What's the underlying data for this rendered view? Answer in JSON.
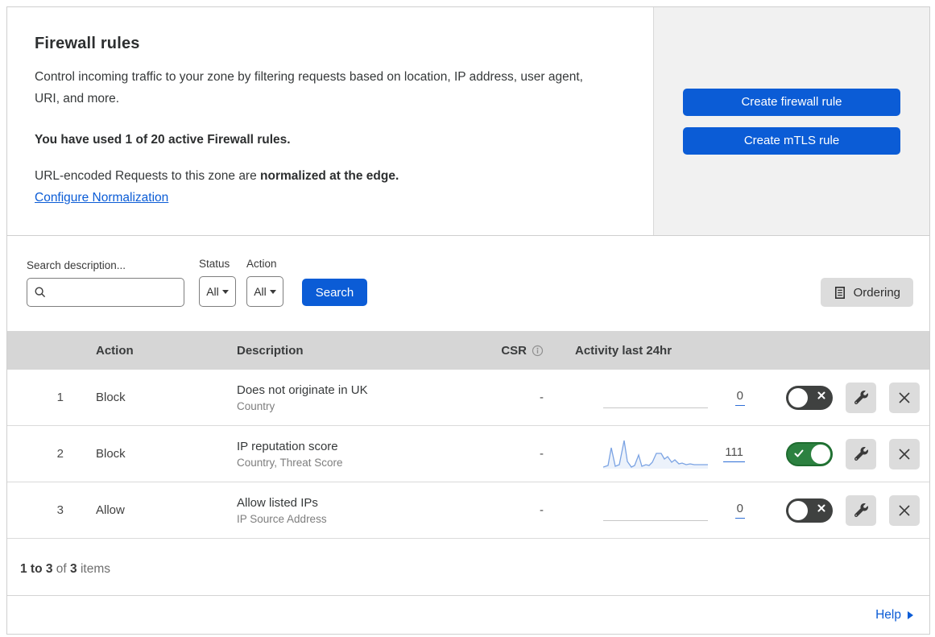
{
  "hero": {
    "title": "Firewall rules",
    "description": "Control incoming traffic to your zone by filtering requests based on location, IP address, user agent, URI, and more.",
    "usage": "You have used 1 of 20 active Firewall rules.",
    "normalization_prefix": "URL-encoded Requests to this zone are ",
    "normalization_bold": "normalized at the edge.",
    "normalization_link": "Configure Normalization",
    "buttons": [
      {
        "label": "Create firewall rule"
      },
      {
        "label": "Create mTLS rule"
      }
    ]
  },
  "filters": {
    "search_label": "Search description...",
    "search_value": "",
    "status_label": "Status",
    "status_value": "All",
    "action_label": "Action",
    "action_value": "All",
    "search_button": "Search",
    "ordering_button": "Ordering"
  },
  "table": {
    "columns": {
      "action": "Action",
      "description": "Description",
      "csr": "CSR",
      "activity": "Activity last 24hr"
    },
    "rows": [
      {
        "num": "1",
        "action": "Block",
        "title": "Does not originate in UK",
        "subtitle": "Country",
        "csr": "-",
        "activity_value": "0",
        "enabled": false,
        "sparkline": null
      },
      {
        "num": "2",
        "action": "Block",
        "title": "IP reputation score",
        "subtitle": "Country, Threat Score",
        "csr": "-",
        "activity_value": "111",
        "enabled": true,
        "sparkline": [
          [
            0,
            38
          ],
          [
            6,
            36
          ],
          [
            10,
            14
          ],
          [
            15,
            37
          ],
          [
            20,
            35
          ],
          [
            26,
            5
          ],
          [
            30,
            31
          ],
          [
            35,
            38
          ],
          [
            39,
            36
          ],
          [
            44,
            23
          ],
          [
            48,
            37
          ],
          [
            53,
            35
          ],
          [
            57,
            36
          ],
          [
            61,
            32
          ],
          [
            66,
            21
          ],
          [
            72,
            21
          ],
          [
            76,
            28
          ],
          [
            80,
            25
          ],
          [
            85,
            32
          ],
          [
            89,
            29
          ],
          [
            94,
            34
          ],
          [
            98,
            33
          ],
          [
            103,
            35
          ],
          [
            108,
            34
          ],
          [
            113,
            35
          ],
          [
            119,
            35
          ],
          [
            125,
            35
          ],
          [
            130,
            35
          ]
        ]
      },
      {
        "num": "3",
        "action": "Allow",
        "title": "Allow listed IPs",
        "subtitle": "IP Source Address",
        "csr": "-",
        "activity_value": "0",
        "enabled": false,
        "sparkline": null
      }
    ]
  },
  "footer": {
    "range": "1 to 3",
    "of": " of ",
    "total": "3",
    "items": " items",
    "help": "Help"
  },
  "colors": {
    "primary_blue": "#0b5cd6",
    "toggle_on_green": "#2c8140",
    "toggle_off_dark": "#3f4140",
    "sparkline_blue": "#7ba3e3",
    "table_header_bg": "#d6d6d6",
    "side_panel_gray": "#f1f1f1",
    "gray_button": "#dcdcdc"
  }
}
